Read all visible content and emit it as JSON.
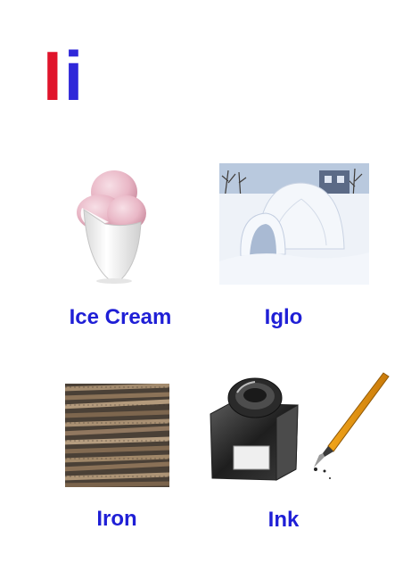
{
  "letter": {
    "upper": "I",
    "lower": "i"
  },
  "colors": {
    "upper": "#e0142b",
    "lower": "#2f27d9",
    "label": "#1f1fd6"
  },
  "items": [
    {
      "label": "Ice Cream",
      "icon": "ice-cream-image"
    },
    {
      "label": "Iglo",
      "icon": "igloo-image"
    },
    {
      "label": "Iron",
      "icon": "iron-rods-image"
    },
    {
      "label": "Ink",
      "icon": "ink-bottle-image"
    }
  ]
}
